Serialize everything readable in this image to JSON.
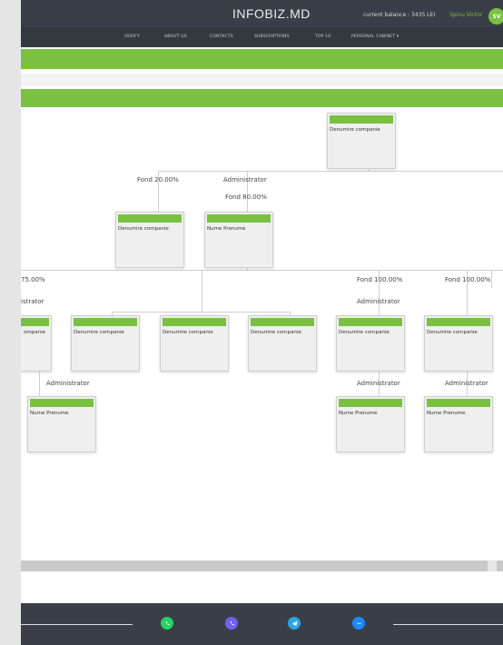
{
  "header": {
    "logo": "INFOBIZ.MD",
    "balance": "current balance : 3435 LEI",
    "user": "Spinu Victor",
    "avatar": "SV"
  },
  "nav": {
    "items": [
      "VERIFY",
      "ABOUT US",
      "CONTACTS",
      "SUBSCRIPTIONS",
      "TOP 10",
      "PERSONAL CABINET ▾"
    ]
  },
  "org": {
    "top": "Denumire companie",
    "level2": {
      "left_fond": "Fond 20.00%",
      "right_role": "Administrator",
      "right_fond": "Fond 80.00%",
      "left_card": "Denumire companie",
      "right_card": "Nume Prenume"
    },
    "level3": {
      "fond_left": "75.00%",
      "role_left": "istrator",
      "fond_mid": "Fond 100.00%",
      "role_mid": "Administrator",
      "fond_right": "Fond 100.00%",
      "cards": [
        "ompanie",
        "Denumire companie",
        "Denumire companie",
        "Denumire companie",
        "Denumire companie",
        "Denumire companie"
      ]
    },
    "level4": {
      "role_a": "Administrator",
      "role_b": "Administrator",
      "role_c": "Administrator",
      "card_a": "Nume Prenume",
      "card_b": "Nume Prenume",
      "card_c": "Nume Prenume"
    }
  },
  "footer": {
    "icons": [
      "whatsapp-icon",
      "viber-icon",
      "telegram-icon",
      "messenger-icon"
    ],
    "colors": {
      "whatsapp": "#25d366",
      "viber": "#7360f2",
      "telegram": "#2ca5e0",
      "messenger": "#1e88ff"
    }
  },
  "colors": {
    "accent": "#7ac142",
    "header": "#3a3f47"
  }
}
